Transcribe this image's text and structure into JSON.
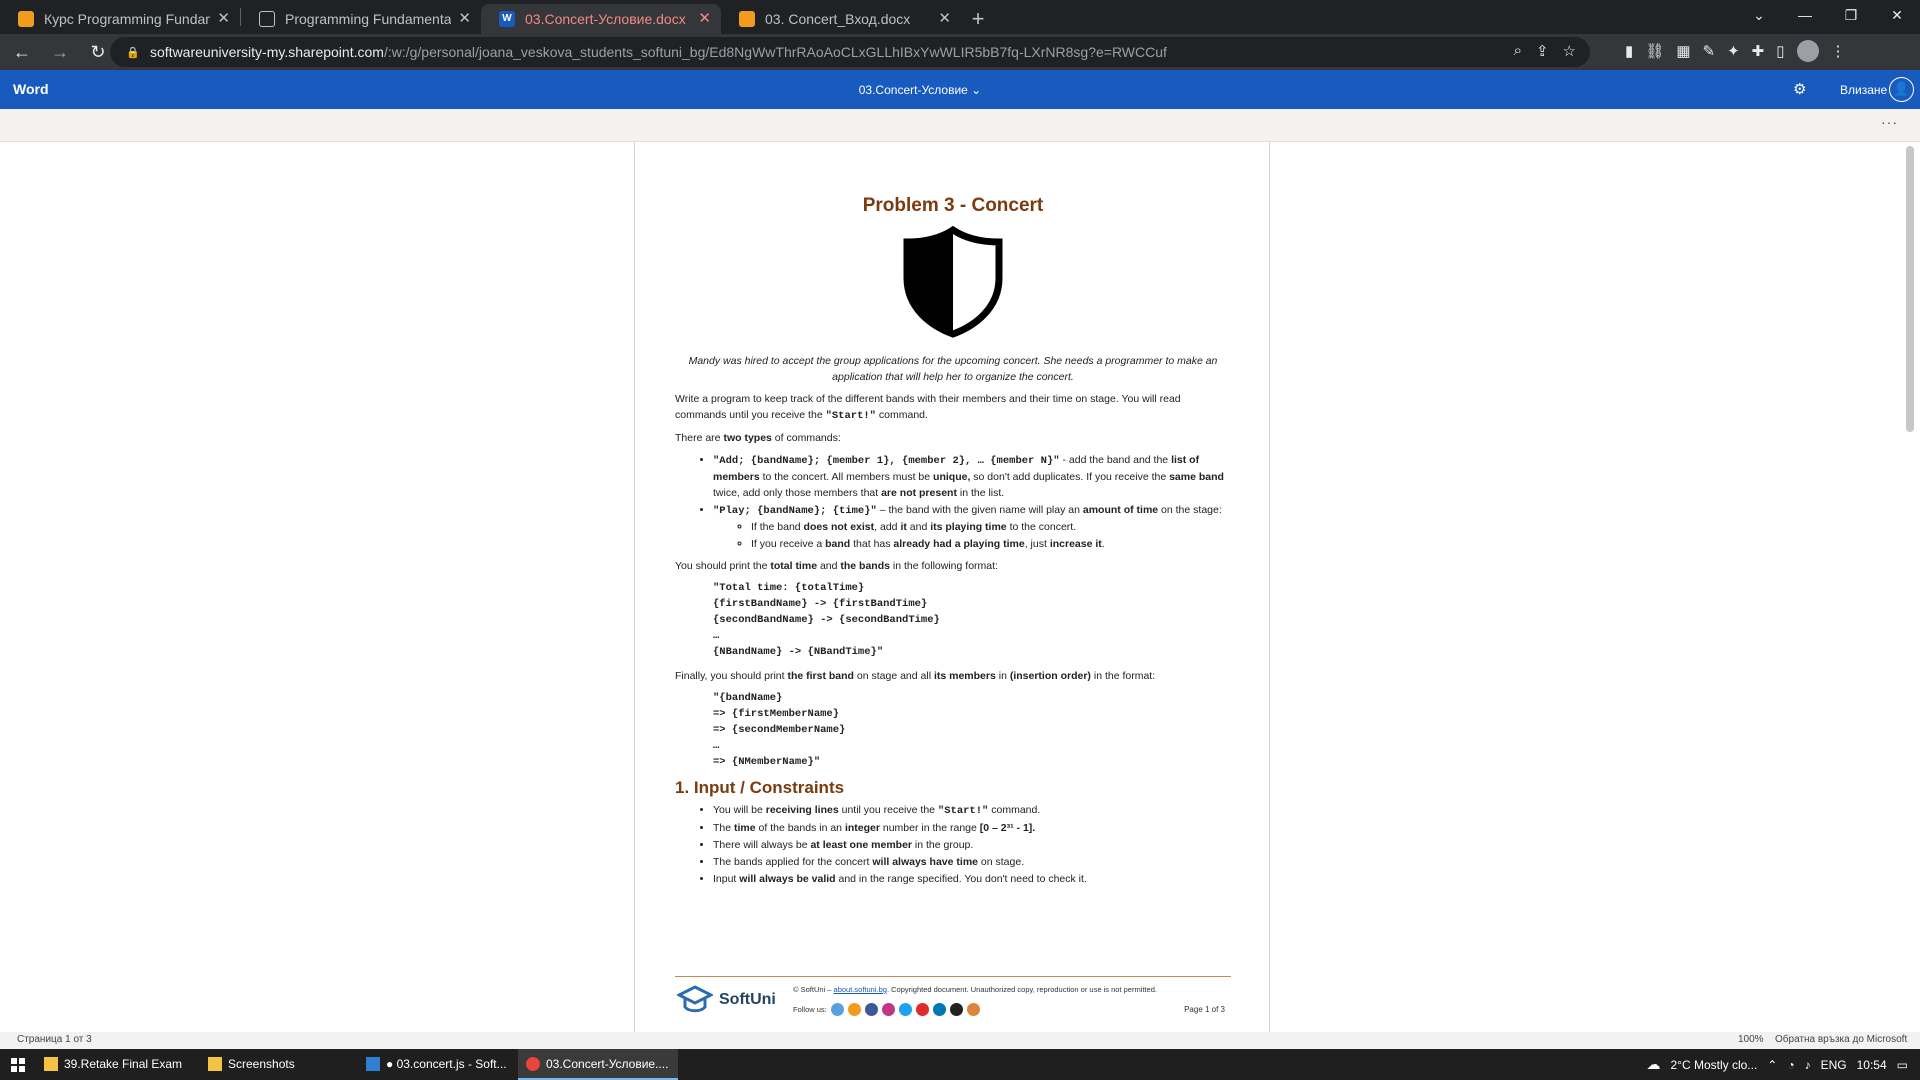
{
  "browser": {
    "tabs": [
      {
        "title": "Курс Programming Fundamentals",
        "icon": "softuni-icon"
      },
      {
        "title": "Programming Fundamentals Final",
        "icon": "page-icon"
      },
      {
        "title": "03.Concert-Условие.docx",
        "icon": "word-icon",
        "active": true
      },
      {
        "title": "03. Concert_Вход.docx",
        "icon": "softuni-icon"
      }
    ],
    "new_tab": "+",
    "url_host": "softwareuniversity-my.sharepoint.com",
    "url_path": "/:w:/g/personal/joana_veskova_students_softuni_bg/Ed8NgWwThrRAoAoCLxGLLhIBxYwWLIR5bB7fq-LXrNR8sg?e=RWCCuf"
  },
  "word": {
    "brand": "Word",
    "doc_title": "03.Concert-Условие",
    "signin": "Влизане"
  },
  "document": {
    "title": "Problem 3 - Concert",
    "intro": "Mandy was hired to accept the group applications for the upcoming concert. She needs a programmer to make an application that will help her to organize the concert.",
    "p1_a": "Write a program to keep track of the different bands with their members and their time on stage. You will read commands until you receive the ",
    "p1_code": "\"Start!\"",
    "p1_b": " command.",
    "p2_a": "There are ",
    "p2_bold": "two types",
    "p2_b": " of commands:",
    "cmd1_code": "\"Add; {bandName}; {member 1}, {member 2}, … {member N}\"",
    "cmd1_a": " - add the band and the ",
    "cmd1_b1": "list of members",
    "cmd1_b": " to the concert. All members must be ",
    "cmd1_b2": "unique,",
    "cmd1_c": " so don't add duplicates. If you receive the ",
    "cmd1_b3": "same band",
    "cmd1_d": " twice, add only those members that ",
    "cmd1_b4": "are not present",
    "cmd1_e": " in the list.",
    "cmd2_code": "\"Play; {bandName}; {time}\"",
    "cmd2_a": " – the band with the given name will play an ",
    "cmd2_b1": "amount of time",
    "cmd2_b": " on the stage:",
    "sub1_a": "If the band ",
    "sub1_b1": "does not exist",
    "sub1_b": ", add ",
    "sub1_b2": "it",
    "sub1_c": " and ",
    "sub1_b3": "its playing time",
    "sub1_d": " to the concert.",
    "sub2_a": "If you receive a ",
    "sub2_b1": "band",
    "sub2_b": " that has ",
    "sub2_b2": "already had a playing time",
    "sub2_c": ", just ",
    "sub2_b3": "increase it",
    "sub2_d": ".",
    "p3_a": "You should print the ",
    "p3_b1": "total time",
    "p3_b": " and ",
    "p3_b2": "the bands",
    "p3_c": " in the following format:",
    "code1": "\"Total time: {totalTime}\n{firstBandName} -> {firstBandTime}\n{secondBandName} -> {secondBandTime}\n…\n{NBandName} -> {NBandTime}\"",
    "p4_a": "Finally, you should print ",
    "p4_b1": "the first band",
    "p4_b": " on stage and all ",
    "p4_b2": "its members",
    "p4_c": " in ",
    "p4_b3": "(insertion order)",
    "p4_d": " in the format:",
    "code2": "\"{bandName}\n=> {firstMemberName}\n=> {secondMemberName}\n…\n=> {NMemberName}\"",
    "section1": "1. Input / Constraints",
    "c1_a": "You will be ",
    "c1_b1": "receiving lines",
    "c1_b": " until you receive the ",
    "c1_code": "\"Start!\"",
    "c1_c": " command.",
    "c2_a": "The ",
    "c2_b1": "time",
    "c2_b": " of the bands in an ",
    "c2_b2": "integer",
    "c2_c": " number in the range ",
    "c2_b3": "[0 – 2³¹ - 1].",
    "c3_a": "There will always be ",
    "c3_b1": "at least one member",
    "c3_b": " in the group.",
    "c4_a": "The bands applied for the concert ",
    "c4_b1": "will always have time",
    "c4_b": " on stage.",
    "c5_a": "Input ",
    "c5_b1": "will always be valid",
    "c5_b": " and in the range specified. You don't need to check it."
  },
  "footer": {
    "logo": "SoftUni",
    "copy_a": "© SoftUni – ",
    "copy_link": "about.softuni.bg",
    "copy_b": ". Copyrighted document. Unauthorized copy, reproduction or use is not permitted.",
    "follow": "Follow us:",
    "page": "Page 1 of 3"
  },
  "status": {
    "page": "Страница 1 от 3",
    "zoom": "100%",
    "feedback": "Обратна връзка до Microsoft"
  },
  "taskbar": {
    "apps": [
      {
        "label": "39.Retake Final Exam",
        "icon": "folder-icon"
      },
      {
        "label": "Screenshots",
        "icon": "folder-icon"
      },
      {
        "label": "● 03.concert.js - Soft...",
        "icon": "vscode-icon"
      },
      {
        "label": "03.Concert-Условие....",
        "icon": "chrome-icon",
        "active": true
      }
    ],
    "weather": "2°C  Mostly clo...",
    "lang": "ENG",
    "time": "10:54"
  },
  "colors": {
    "word_blue": "#185abd",
    "title_brown": "#7a3b0e",
    "chrome_dark": "#202124"
  }
}
